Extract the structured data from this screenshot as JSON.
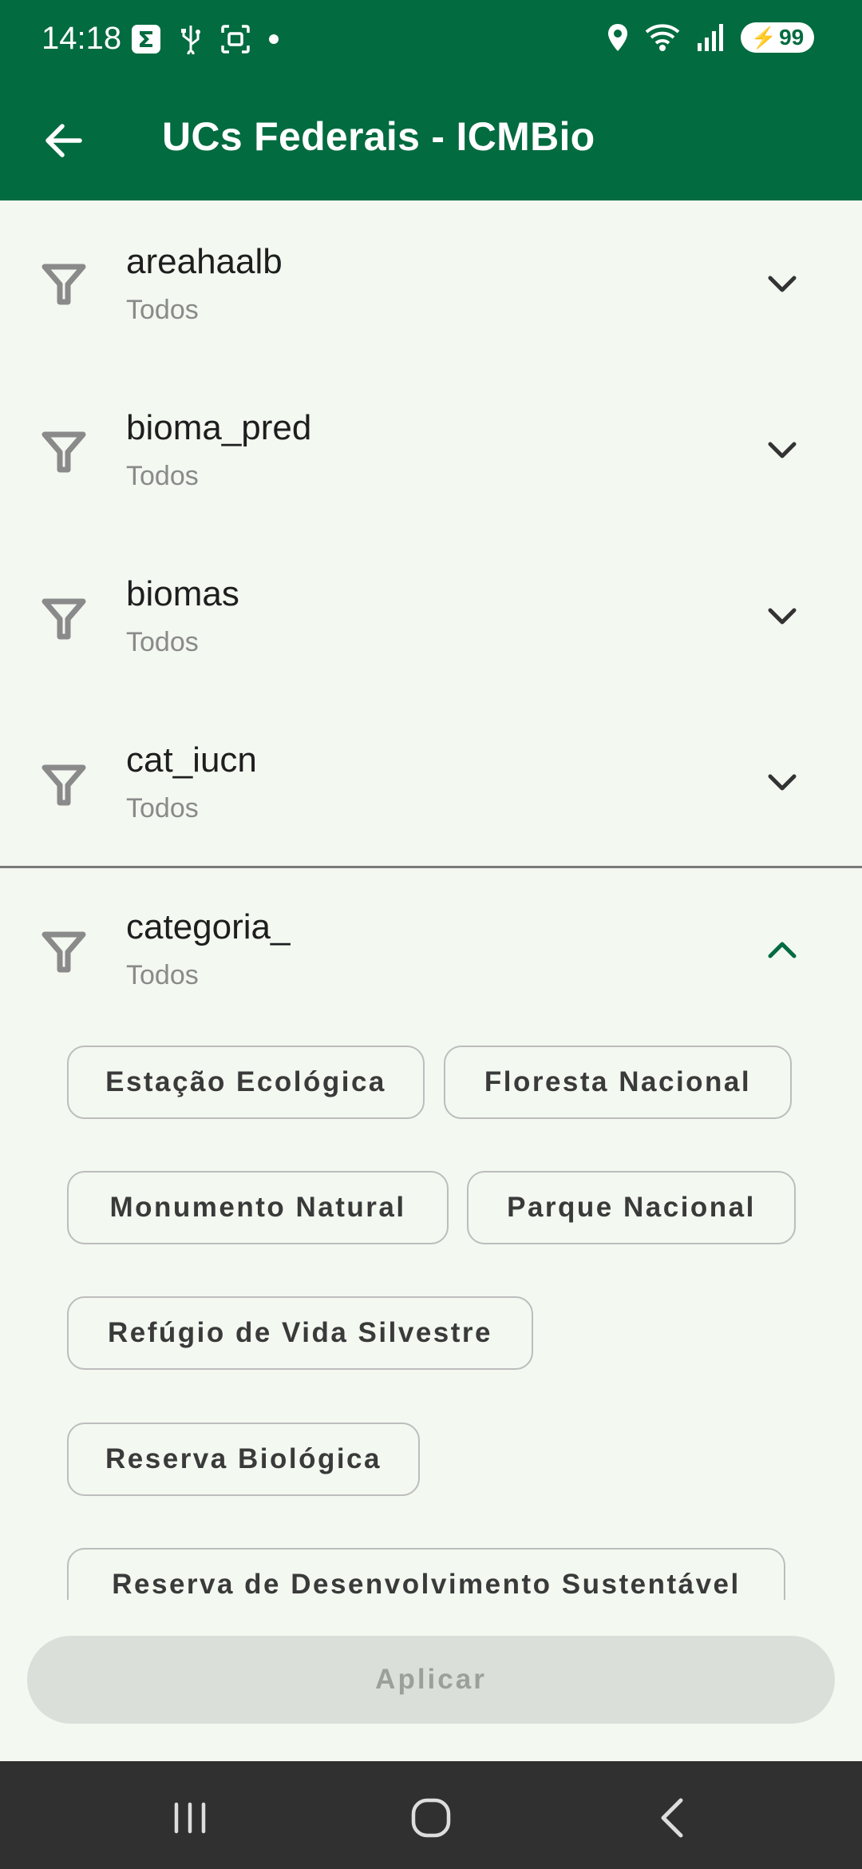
{
  "status": {
    "time": "14:18",
    "battery": "99",
    "left_icons": [
      "sigma-notification-icon",
      "usb-icon",
      "screenshot-icon",
      "dot-icon"
    ],
    "right_icons": [
      "location-icon",
      "wifi-icon",
      "signal-icon",
      "battery-charging-icon"
    ]
  },
  "app_bar": {
    "title": "UCs Federais - ICMBio",
    "back_icon": "arrow-back-icon"
  },
  "filters": [
    {
      "name": "areahaalb",
      "value": "Todos",
      "expanded": false
    },
    {
      "name": "bioma_pred",
      "value": "Todos",
      "expanded": false
    },
    {
      "name": "biomas",
      "value": "Todos",
      "expanded": false
    },
    {
      "name": "cat_iucn",
      "value": "Todos",
      "expanded": false
    },
    {
      "name": "categoria_",
      "value": "Todos",
      "expanded": true
    }
  ],
  "categoria_options": [
    "Estação Ecológica",
    "Floresta Nacional",
    "Monumento Natural",
    "Parque Nacional",
    "Refúgio de Vida Silvestre",
    "Reserva Biológica",
    "Reserva de Desenvolvimento Sustentável"
  ],
  "apply_label": "Aplicar",
  "colors": {
    "primary": "#026b40",
    "background": "#f3f8f1",
    "chip_border": "#bdbdbd",
    "apply_disabled_bg": "#dadfd9",
    "nav_bar": "#303030"
  }
}
